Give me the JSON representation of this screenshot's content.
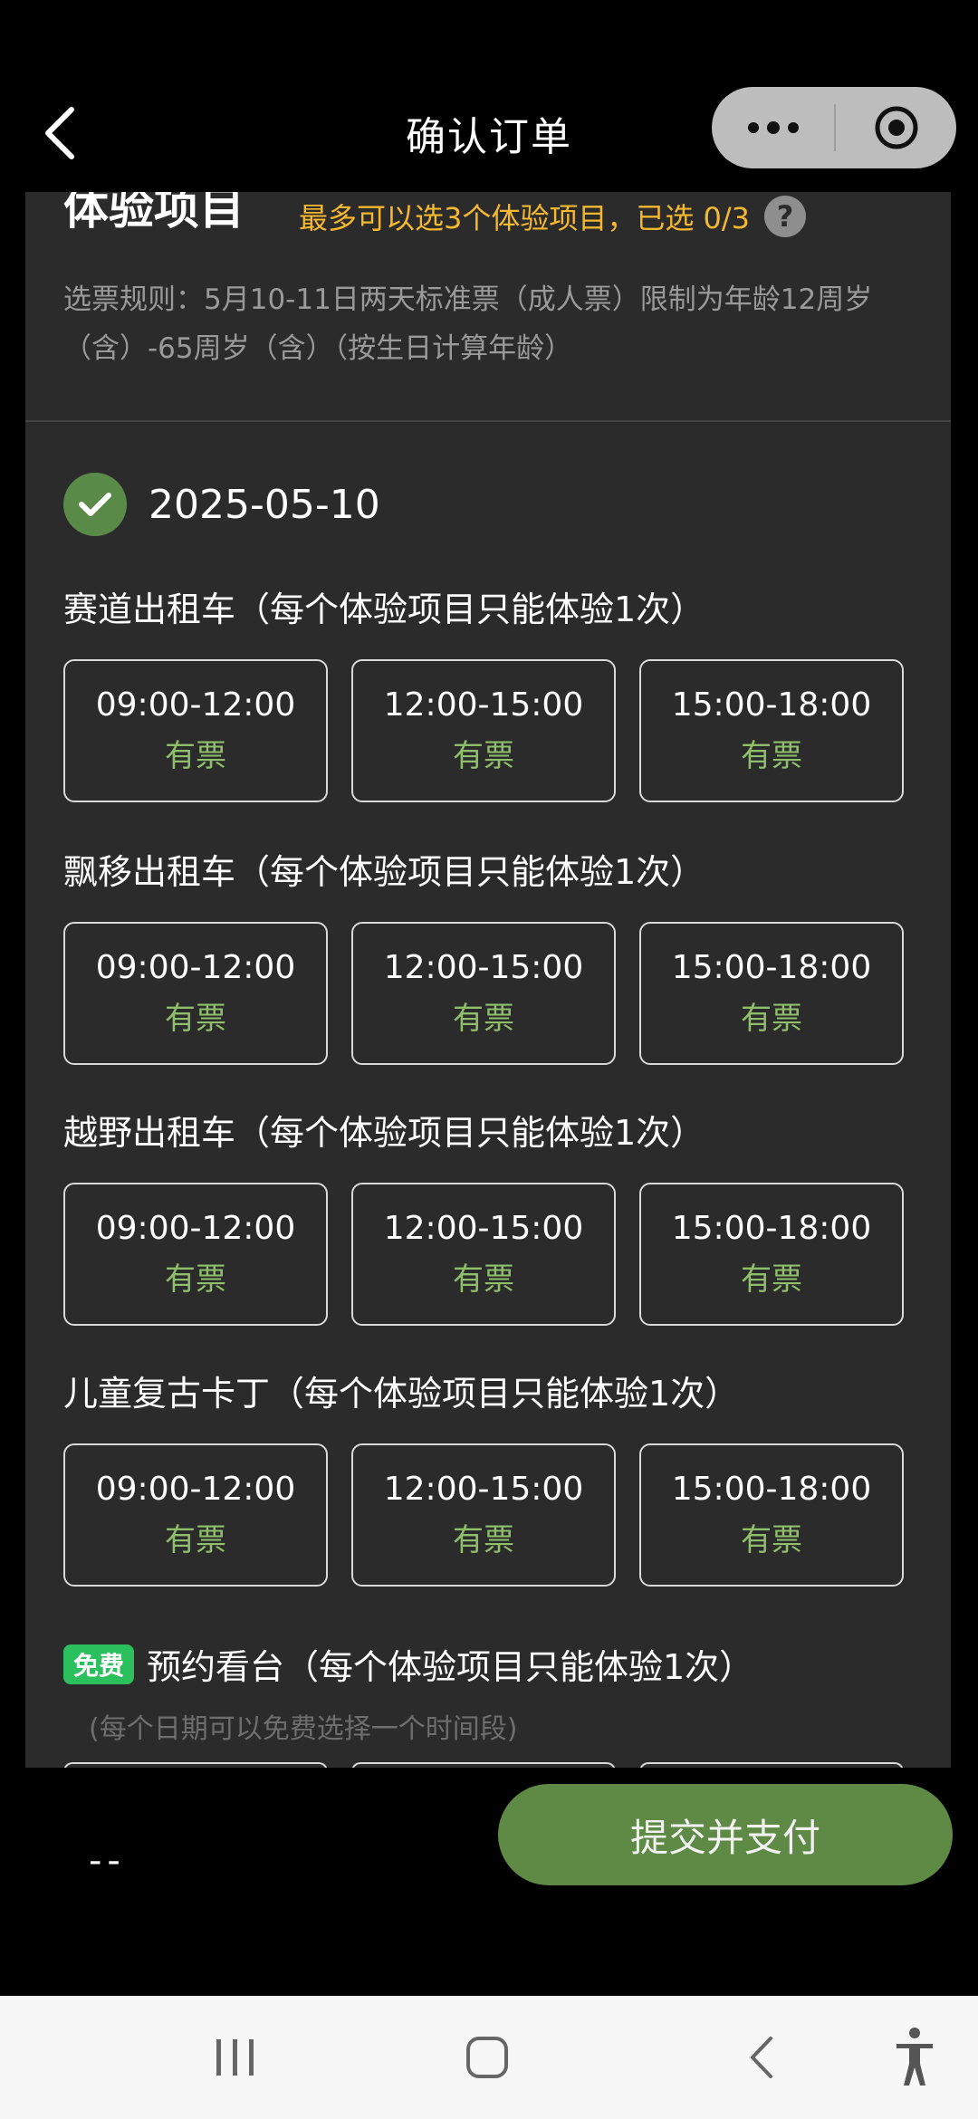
{
  "header": {
    "title": "确认订单"
  },
  "section": {
    "title": "体验项目",
    "hint": "最多可以选3个体验项目，已选 0/3",
    "help": "?",
    "rule": "选票规则：5月10-11日两天标准票（成人票）限制为年龄12周岁（含）-65周岁（含）（按生日计算年龄）"
  },
  "date": "2025-05-10",
  "items": [
    {
      "title": "赛道出租车（每个体验项目只能体验1次）",
      "slots": [
        {
          "time": "09:00-12:00",
          "status": "有票"
        },
        {
          "time": "12:00-15:00",
          "status": "有票"
        },
        {
          "time": "15:00-18:00",
          "status": "有票"
        }
      ]
    },
    {
      "title": "飘移出租车（每个体验项目只能体验1次）",
      "slots": [
        {
          "time": "09:00-12:00",
          "status": "有票"
        },
        {
          "time": "12:00-15:00",
          "status": "有票"
        },
        {
          "time": "15:00-18:00",
          "status": "有票"
        }
      ]
    },
    {
      "title": "越野出租车（每个体验项目只能体验1次）",
      "slots": [
        {
          "time": "09:00-12:00",
          "status": "有票"
        },
        {
          "time": "12:00-15:00",
          "status": "有票"
        },
        {
          "time": "15:00-18:00",
          "status": "有票"
        }
      ]
    },
    {
      "title": "儿童复古卡丁（每个体验项目只能体验1次）",
      "slots": [
        {
          "time": "09:00-12:00",
          "status": "有票"
        },
        {
          "time": "12:00-15:00",
          "status": "有票"
        },
        {
          "time": "15:00-18:00",
          "status": "有票"
        }
      ]
    }
  ],
  "free_item": {
    "badge": "免费",
    "title": "预约看台（每个体验项目只能体验1次）",
    "note": "(每个日期可以免费选择一个时间段)"
  },
  "footer": {
    "price": "--",
    "pay_label": "提交并支付"
  },
  "colors": {
    "accent_green": "#5f8a45",
    "hint_orange": "#f5b82e",
    "available_green": "#8fbf6a",
    "free_badge": "#2bbf5e"
  }
}
